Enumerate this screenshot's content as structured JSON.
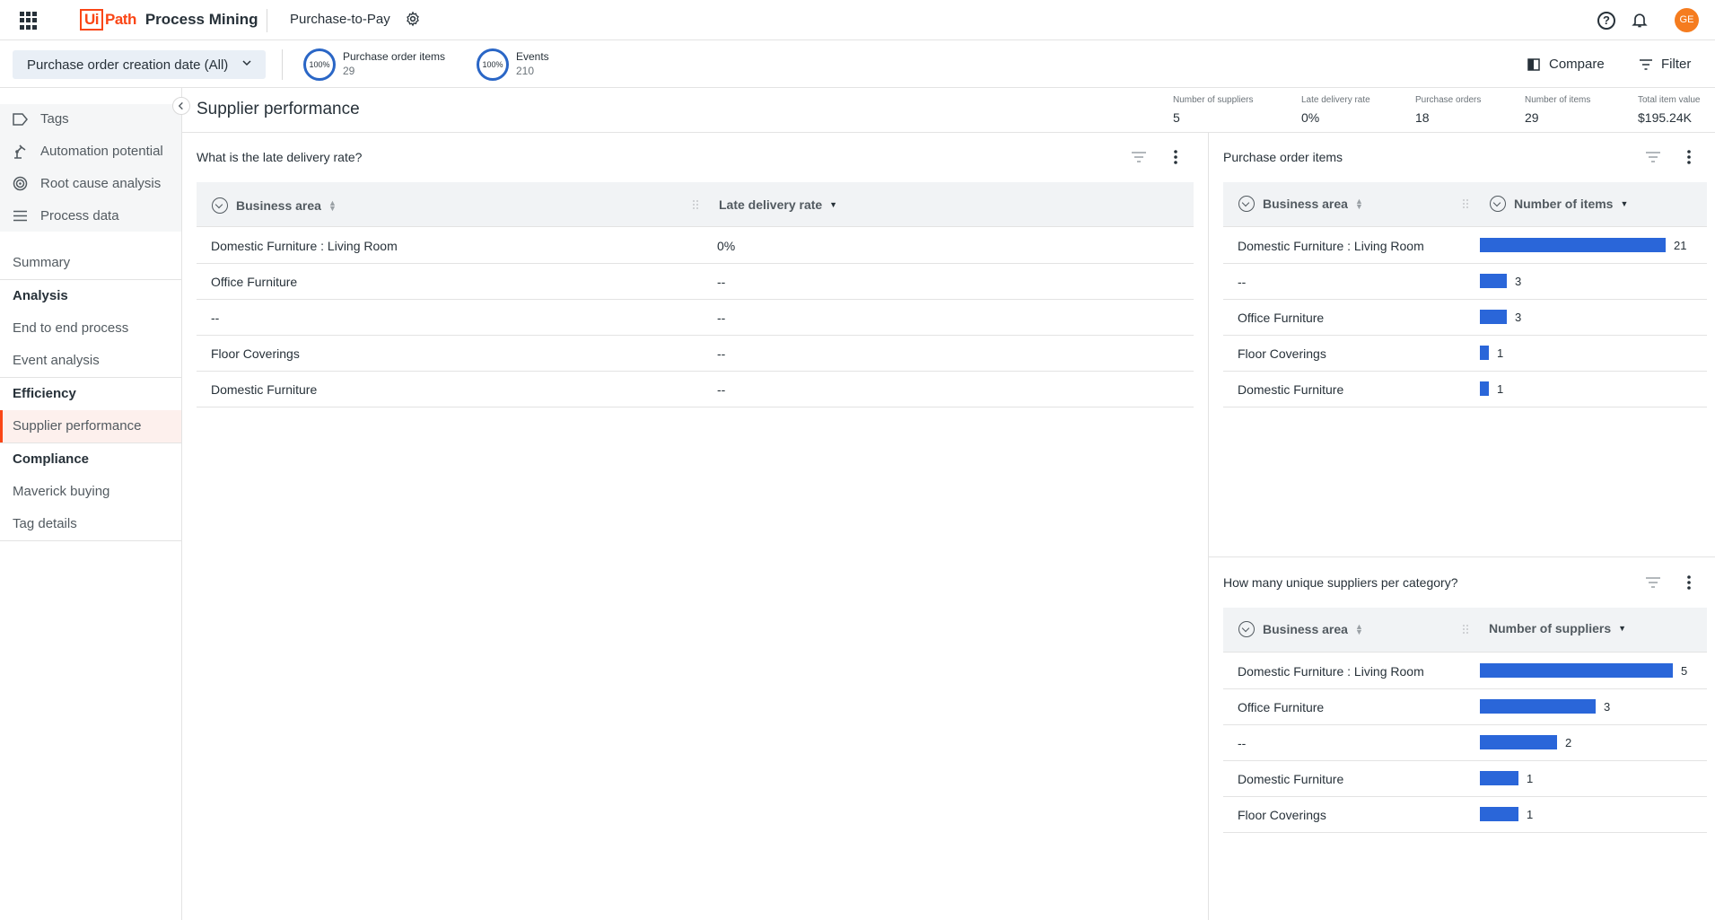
{
  "topbar": {
    "logo_box": "Ui",
    "logo_path": "Path",
    "product": "Process Mining",
    "process_name": "Purchase-to-Pay",
    "help_glyph": "?",
    "avatar_initials": "GE",
    "avatar_color": "#f57c1f",
    "brand_color": "#fa4616"
  },
  "filterbar": {
    "date_filter": "Purchase order creation date (All)",
    "kpis": [
      {
        "percent": "100%",
        "label": "Purchase order items",
        "value": "29"
      },
      {
        "percent": "100%",
        "label": "Events",
        "value": "210"
      }
    ],
    "compare": "Compare",
    "filter": "Filter"
  },
  "sidebar": {
    "tools": [
      "Tags",
      "Automation potential",
      "Root cause analysis",
      "Process data"
    ],
    "summary": "Summary",
    "sections": [
      {
        "heading": "Analysis",
        "items": [
          "End to end process",
          "Event analysis"
        ]
      },
      {
        "heading": "Efficiency",
        "items": [
          "Supplier performance"
        ]
      },
      {
        "heading": "Compliance",
        "items": [
          "Maverick buying",
          "Tag details"
        ]
      }
    ]
  },
  "page": {
    "title": "Supplier performance",
    "stats": [
      {
        "label": "Number of suppliers",
        "value": "5"
      },
      {
        "label": "Late delivery rate",
        "value": "0%"
      },
      {
        "label": "Purchase orders",
        "value": "18"
      },
      {
        "label": "Number of items",
        "value": "29"
      },
      {
        "label": "Total item value",
        "value": "$195.24K"
      }
    ]
  },
  "late_delivery": {
    "title": "What is the late delivery rate?",
    "col1": "Business area",
    "col2": "Late delivery rate",
    "rows": [
      {
        "area": "Domestic Furniture : Living Room",
        "rate": "0%"
      },
      {
        "area": "Office Furniture",
        "rate": "--"
      },
      {
        "area": "--",
        "rate": "--"
      },
      {
        "area": "Floor Coverings",
        "rate": "--"
      },
      {
        "area": "Domestic Furniture",
        "rate": "--"
      }
    ]
  },
  "po_items": {
    "title": "Purchase order items",
    "col1": "Business area",
    "col2": "Number of items",
    "bar_color": "#2a66d9",
    "rows": [
      {
        "area": "Domestic Furniture : Living Room",
        "value": 21
      },
      {
        "area": "--",
        "value": 3
      },
      {
        "area": "Office Furniture",
        "value": 3
      },
      {
        "area": "Floor Coverings",
        "value": 1
      },
      {
        "area": "Domestic Furniture",
        "value": 1
      }
    ]
  },
  "suppliers": {
    "title": "How many unique suppliers per category?",
    "col1": "Business area",
    "col2": "Number of suppliers",
    "bar_color": "#2a66d9",
    "rows": [
      {
        "area": "Domestic Furniture : Living Room",
        "value": 5
      },
      {
        "area": "Office Furniture",
        "value": 3
      },
      {
        "area": "--",
        "value": 2
      },
      {
        "area": "Domestic Furniture",
        "value": 1
      },
      {
        "area": "Floor Coverings",
        "value": 1
      }
    ]
  }
}
